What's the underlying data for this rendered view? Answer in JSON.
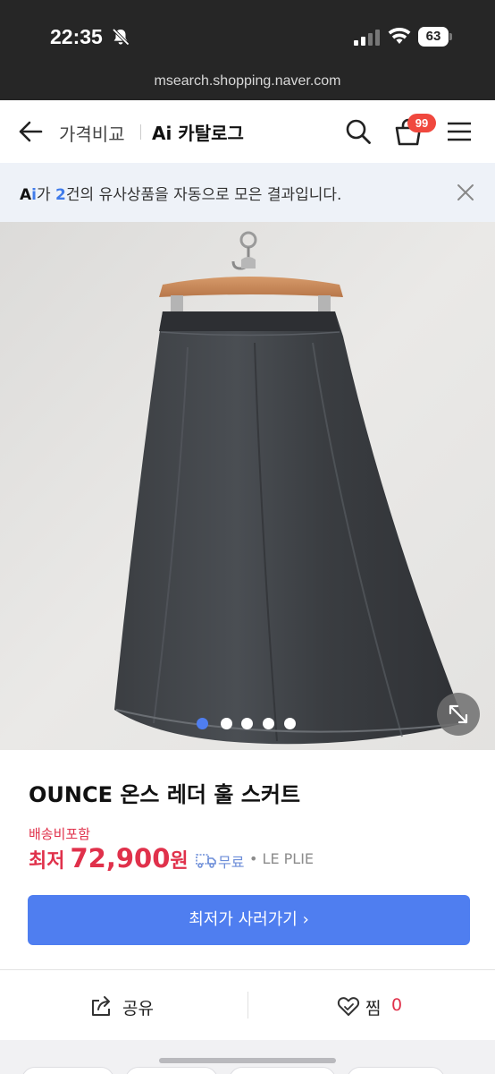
{
  "status_bar": {
    "time": "22:35",
    "battery": "63"
  },
  "browser": {
    "url": "msearch.shopping.naver.com"
  },
  "header": {
    "compare_label": "가격비교",
    "catalog_label": "Ai 카탈로그",
    "cart_count": "99"
  },
  "ai_banner": {
    "ai_mark_a": "A",
    "ai_mark_i": "i",
    "text_before": "가 ",
    "count": "2",
    "text_after": "건의 유사상품을 자동으로 모은 결과입니다."
  },
  "gallery": {
    "total_images": 5,
    "current_index": 1
  },
  "product": {
    "title": "OUNCE 온스 레더 훌 스커트",
    "shipping_note": "배송비포함",
    "price_label": "최저",
    "price_value": "72,900",
    "price_unit": "원",
    "free_shipping": "무료",
    "seller": "• LE PLIE"
  },
  "buy_button": {
    "label": "최저가 사러가기 ›"
  },
  "actions": {
    "share_label": "공유",
    "zzim_label": "찜",
    "zzim_count": "0"
  },
  "colors": {
    "accent_blue": "#4f7ef0",
    "price_red": "#e0314b",
    "badge_red": "#f0483e",
    "banner_bg": "#eef2f8"
  },
  "icons": [
    "bell-slash-icon",
    "signal-icon",
    "wifi-icon",
    "back-arrow-icon",
    "search-icon",
    "cart-icon",
    "menu-icon",
    "close-icon",
    "expand-icon",
    "truck-icon",
    "share-icon",
    "heart-icon"
  ]
}
